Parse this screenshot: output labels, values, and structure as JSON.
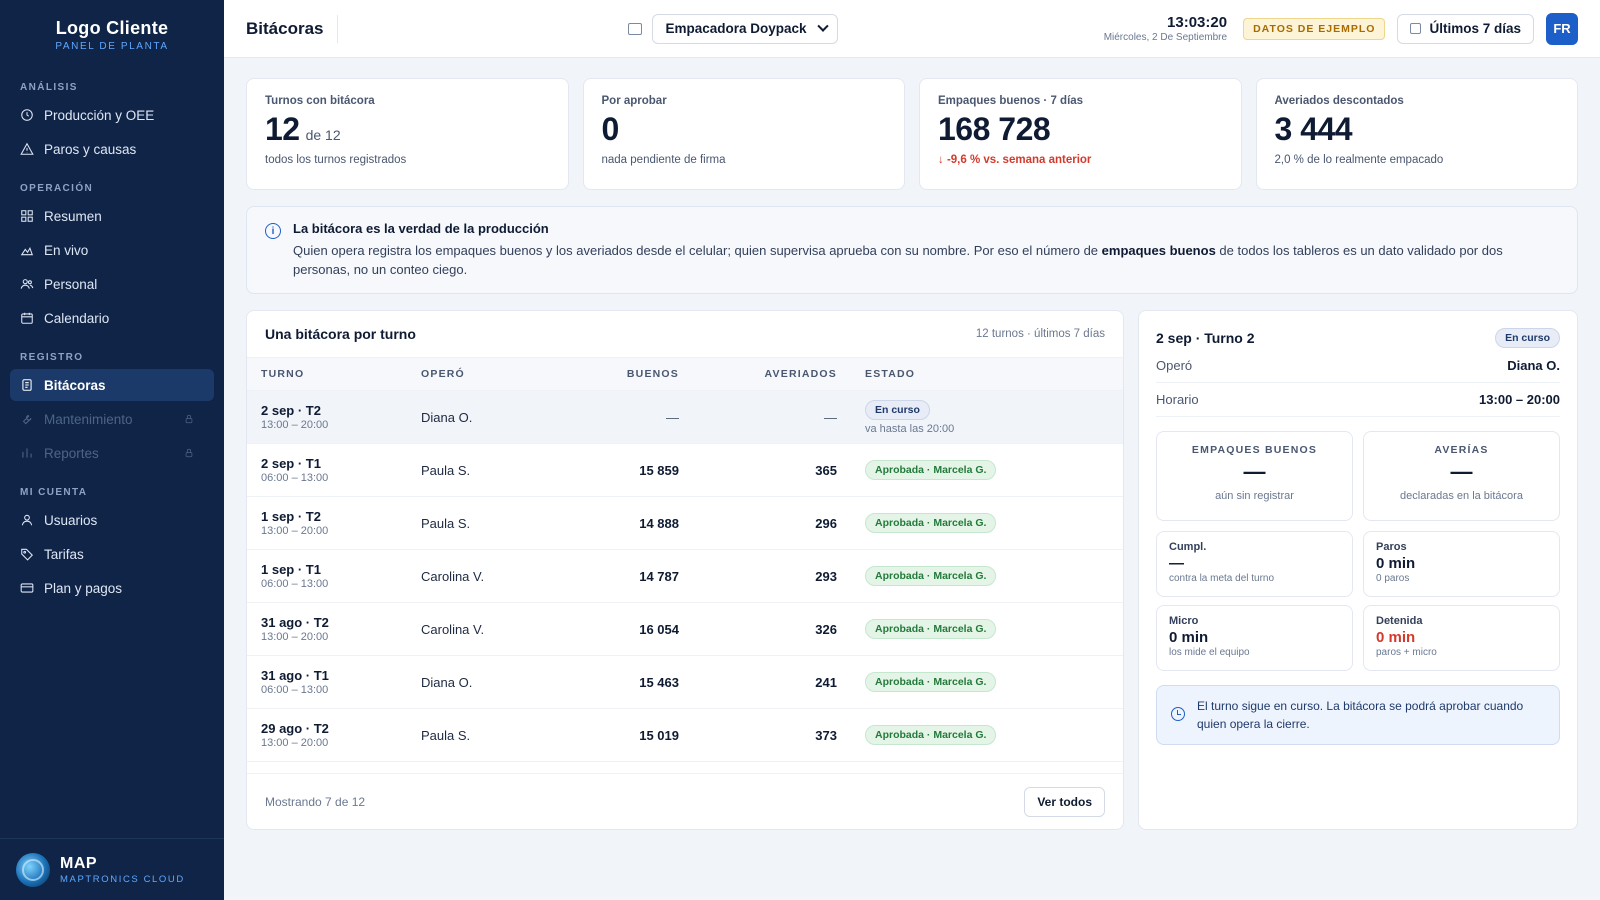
{
  "brand": {
    "title": "Logo Cliente",
    "subtitle": "PANEL DE PLANTA"
  },
  "sidebar": {
    "sections": [
      {
        "label": "ANÁLISIS",
        "items": [
          {
            "label": "Producción y OEE",
            "icon": "clock-icon"
          },
          {
            "label": "Paros y causas",
            "icon": "warning-icon"
          }
        ]
      },
      {
        "label": "OPERACIÓN",
        "items": [
          {
            "label": "Resumen",
            "icon": "grid-icon"
          },
          {
            "label": "En vivo",
            "icon": "activity-icon"
          },
          {
            "label": "Personal",
            "icon": "users-icon"
          },
          {
            "label": "Calendario",
            "icon": "calendar-icon"
          }
        ]
      },
      {
        "label": "REGISTRO",
        "items": [
          {
            "label": "Bitácoras",
            "icon": "clipboard-icon",
            "active": true
          },
          {
            "label": "Mantenimiento",
            "icon": "wrench-icon",
            "locked": true
          },
          {
            "label": "Reportes",
            "icon": "bar-chart-icon",
            "locked": true
          }
        ]
      },
      {
        "label": "MI CUENTA",
        "items": [
          {
            "label": "Usuarios",
            "icon": "user-icon"
          },
          {
            "label": "Tarifas",
            "icon": "tag-icon"
          },
          {
            "label": "Plan y pagos",
            "icon": "credit-card-icon"
          }
        ]
      }
    ],
    "footer": {
      "title": "MAP",
      "subtitle": "MAPTRONICS CLOUD"
    }
  },
  "topbar": {
    "title": "Bitácoras",
    "machine": "Empacadora Doypack",
    "time": "13:03:20",
    "date": "Miércoles, 2 De Septiembre",
    "demo_badge": "DATOS DE EJEMPLO",
    "range": "Últimos 7 días",
    "avatar": "FR"
  },
  "kpis": [
    {
      "label": "Turnos con bitácora",
      "value": "12",
      "of": "de 12",
      "note": "todos los turnos registrados",
      "negative": false
    },
    {
      "label": "Por aprobar",
      "value": "0",
      "of": "",
      "note": "nada pendiente de firma",
      "negative": false
    },
    {
      "label": "Empaques buenos · 7 días",
      "value": "168 728",
      "of": "",
      "note": "↓ -9,6 % vs. semana anterior",
      "negative": true
    },
    {
      "label": "Averiados descontados",
      "value": "3 444",
      "of": "",
      "note": "2,0 % de lo realmente empacado",
      "negative": false
    }
  ],
  "banner": {
    "title": "La bitácora es la verdad de la producción",
    "text_before": "Quien opera registra los empaques buenos y los averiados desde el celular; quien supervisa aprueba con su nombre. Por eso el número de ",
    "text_bold": "empaques buenos",
    "text_after": " de todos los tableros es un dato validado por dos personas, no un conteo ciego."
  },
  "table": {
    "title": "Una bitácora por turno",
    "meta": "12 turnos · últimos 7 días",
    "columns": [
      "TURNO",
      "OPERÓ",
      "BUENOS",
      "AVERIADOS",
      "ESTADO"
    ],
    "rows": [
      {
        "turn": "2 sep · T2",
        "hours": "13:00 – 20:00",
        "operator": "Diana O.",
        "good": "—",
        "damaged": "—",
        "status": "En curso",
        "status_type": "live",
        "status_sub": "va hasta las 20:00",
        "selected": true
      },
      {
        "turn": "2 sep · T1",
        "hours": "06:00 – 13:00",
        "operator": "Paula S.",
        "good": "15 859",
        "damaged": "365",
        "status": "Aprobada · Marcela G.",
        "status_type": "ok",
        "status_sub": ""
      },
      {
        "turn": "1 sep · T2",
        "hours": "13:00 – 20:00",
        "operator": "Paula S.",
        "good": "14 888",
        "damaged": "296",
        "status": "Aprobada · Marcela G.",
        "status_type": "ok",
        "status_sub": ""
      },
      {
        "turn": "1 sep · T1",
        "hours": "06:00 – 13:00",
        "operator": "Carolina V.",
        "good": "14 787",
        "damaged": "293",
        "status": "Aprobada · Marcela G.",
        "status_type": "ok",
        "status_sub": ""
      },
      {
        "turn": "31 ago · T2",
        "hours": "13:00 – 20:00",
        "operator": "Carolina V.",
        "good": "16 054",
        "damaged": "326",
        "status": "Aprobada · Marcela G.",
        "status_type": "ok",
        "status_sub": ""
      },
      {
        "turn": "31 ago · T1",
        "hours": "06:00 – 13:00",
        "operator": "Diana O.",
        "good": "15 463",
        "damaged": "241",
        "status": "Aprobada · Marcela G.",
        "status_type": "ok",
        "status_sub": ""
      },
      {
        "turn": "29 ago · T2",
        "hours": "13:00 – 20:00",
        "operator": "Paula S.",
        "good": "15 019",
        "damaged": "373",
        "status": "Aprobada · Marcela G.",
        "status_type": "ok",
        "status_sub": ""
      }
    ],
    "showing": "Mostrando 7 de 12",
    "see_all": "Ver todos"
  },
  "detail": {
    "title": "2 sep · Turno 2",
    "status": "En curso",
    "operator_label": "Operó",
    "operator": "Diana O.",
    "schedule_label": "Horario",
    "schedule": "13:00 – 20:00",
    "good": {
      "label": "EMPAQUES BUENOS",
      "value": "—",
      "sub": "aún sin registrar"
    },
    "damage": {
      "label": "AVERÍAS",
      "value": "—",
      "sub": "declaradas en la bitácora"
    },
    "small": [
      {
        "label": "Cumpl.",
        "value": "—",
        "sub": "contra la meta del turno",
        "red": false
      },
      {
        "label": "Paros",
        "value": "0 min",
        "sub": "0 paros",
        "red": false
      },
      {
        "label": "Micro",
        "value": "0 min",
        "sub": "los mide el equipo",
        "red": false
      },
      {
        "label": "Detenida",
        "value": "0 min",
        "sub": "paros + micro",
        "red": true
      }
    ],
    "notice": "El turno sigue en curso. La bitácora se podrá aprobar cuando quien opera la cierre."
  }
}
